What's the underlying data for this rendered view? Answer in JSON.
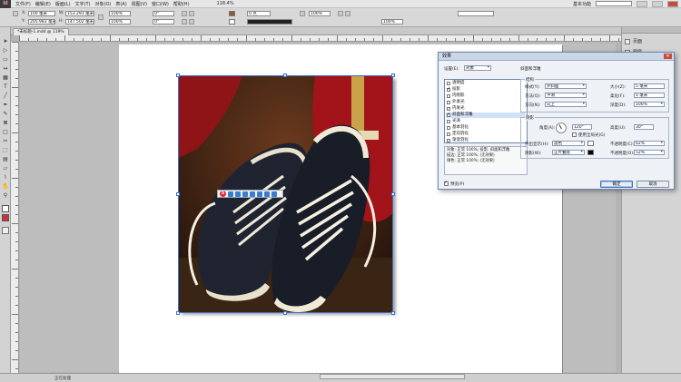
{
  "app": {
    "logo": "Id",
    "menus": [
      "文件(F)",
      "编辑(E)",
      "版面(L)",
      "文字(T)",
      "对象(O)",
      "表(A)",
      "视图(V)",
      "窗口(W)",
      "帮助(H)"
    ],
    "zoom": "118.4%",
    "workspace": "基本功能",
    "search_placeholder": ""
  },
  "control_bar": {
    "x_label": "X:",
    "x_value": "100 毫米",
    "y_label": "Y:",
    "y_value": "205.983 毫米",
    "w_label": "W:",
    "w_value": "153.291 毫米",
    "h_label": "H:",
    "h_value": "147.502 毫米",
    "scale_x": "100%",
    "scale_y": "100%",
    "angle": "0°",
    "shear": "0°",
    "stroke_weight": "0 点",
    "opacity": "100%",
    "zoom_pct": "100%"
  },
  "document_tab": {
    "label": "*未标题-1.indd @ 119%"
  },
  "right_panel": {
    "items": [
      "页面",
      "图层",
      "链接",
      "描边",
      "颜色",
      "色板"
    ]
  },
  "status_bar": {
    "page": "1",
    "status": "无错误",
    "text": "正在处理"
  },
  "effects_dialog": {
    "title": "效果",
    "settings_label": "设置(E):",
    "settings_value": "对象",
    "section_title": "斜面和浮雕",
    "effects_list": [
      {
        "label": "透明度",
        "checked": false,
        "selected": false
      },
      {
        "label": "投影",
        "checked": true,
        "selected": false
      },
      {
        "label": "内阴影",
        "checked": false,
        "selected": false
      },
      {
        "label": "外发光",
        "checked": false,
        "selected": false
      },
      {
        "label": "内发光",
        "checked": false,
        "selected": false
      },
      {
        "label": "斜面和浮雕",
        "checked": true,
        "selected": true
      },
      {
        "label": "光泽",
        "checked": false,
        "selected": false
      },
      {
        "label": "基本羽化",
        "checked": false,
        "selected": false
      },
      {
        "label": "定向羽化",
        "checked": false,
        "selected": false
      },
      {
        "label": "渐变羽化",
        "checked": false,
        "selected": false
      }
    ],
    "summary": [
      "对象: 正常 100%; 投影, 斜面和浮雕",
      "描边: 正常 100%; (无效果)",
      "填色: 正常 100%; (无效果)"
    ],
    "structure": {
      "title": "结构",
      "style_label": "样式(Y):",
      "style_value": "外斜面",
      "method_label": "方法(Q):",
      "method_value": "平滑",
      "direction_label": "方向(N):",
      "direction_value": "向上",
      "size_label": "大小(Z):",
      "size_value": "5 毫米",
      "soften_label": "柔化(F):",
      "soften_value": "0 毫米",
      "depth_label": "深度(D):",
      "depth_value": "100%"
    },
    "shading": {
      "title": "阴影",
      "angle_label": "角度(A):",
      "angle_value": "120°",
      "altitude_label": "高度(U):",
      "altitude_value": "30°",
      "global_light_label": "使用全局光(G)",
      "global_light_checked": false,
      "highlight_label": "突出显示(H):",
      "highlight_value": "滤色",
      "highlight_opacity_label": "不透明度(C):",
      "highlight_opacity_value": "62%",
      "shadow_label": "阴影(W):",
      "shadow_value": "正片叠底",
      "shadow_opacity_label": "不透明度(O):",
      "shadow_opacity_value": "52%"
    },
    "preview_label": "预览(P)",
    "preview_checked": true,
    "ok_label": "确定",
    "cancel_label": "取消"
  },
  "colors": {
    "accent": "#3a6fd0",
    "dialog_bg": "#eef1f6",
    "highlight_swatch": "#ffffff",
    "shadow_swatch": "#000000"
  }
}
